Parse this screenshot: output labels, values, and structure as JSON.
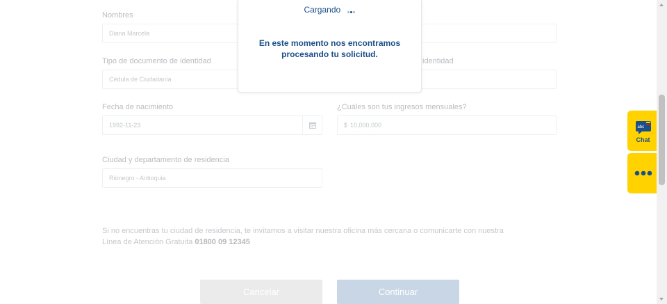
{
  "form": {
    "nombres": {
      "label": "Nombres",
      "value": "Diana Marcela"
    },
    "tipo_documento": {
      "label": "Tipo de documento de identidad",
      "value": "Cédula de Ciudadanía"
    },
    "numero_documento": {
      "label_visible": "identidad"
    },
    "fecha_nacimiento": {
      "label": "Fecha de nacimiento",
      "value": "1992-11-23"
    },
    "ingresos": {
      "label": "¿Cuáles son tus ingresos mensuales?",
      "currency": "$",
      "value": "10,000,000"
    },
    "ciudad": {
      "label": "Ciudad y departamento de residencia",
      "value": "Rionegro - Antioquia"
    }
  },
  "note": {
    "line1": "Si no encuentras tu ciudad de residencia, te invitamos a visitar nuestra oficina más cercana o comunicarte con nuestra",
    "line2_prefix": "Línea de Atención Gratuita ",
    "phone": "01800 09 12345"
  },
  "buttons": {
    "cancel": "Cancelar",
    "continue": "Continuar"
  },
  "modal": {
    "loading": "Cargando",
    "message_line1": "En este momento nos encontramos",
    "message_line2": "procesando tu solicitud."
  },
  "sidebar": {
    "chat_label": "Chat",
    "chat_badge": "abc"
  },
  "colors": {
    "brand_blue": "#1b4f8a",
    "brand_yellow": "#ffd200"
  },
  "icons": [
    "calendar-icon",
    "chat-bubble-icon",
    "more-dots-icon",
    "loading-dots-icon"
  ]
}
